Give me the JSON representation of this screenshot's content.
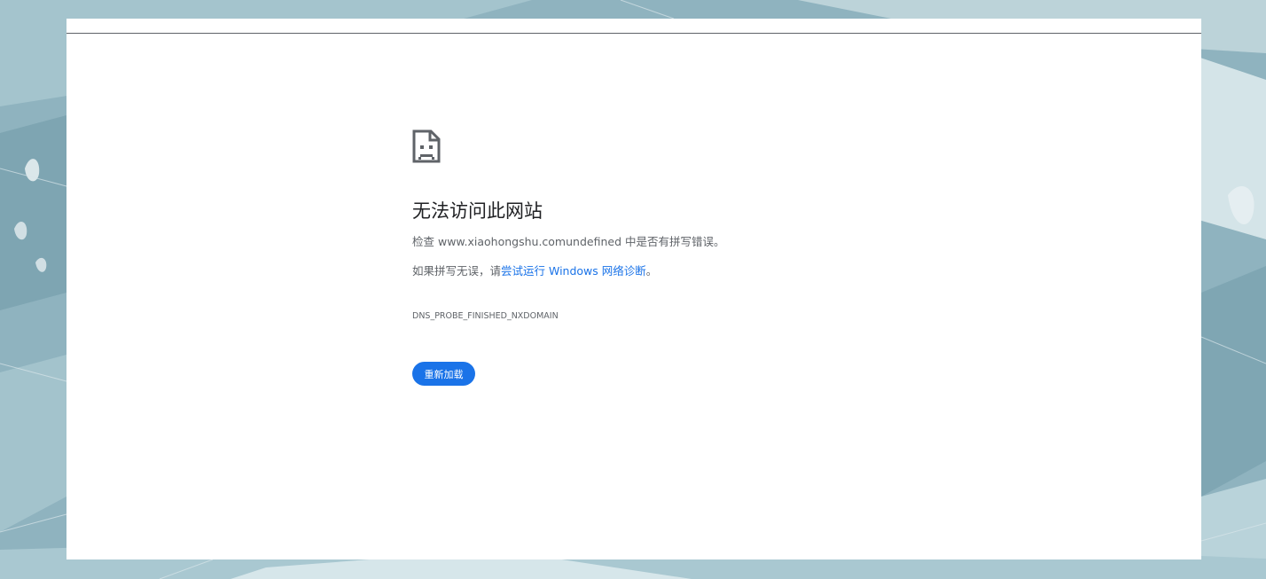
{
  "error_page": {
    "icon": "sad-page-icon",
    "title": "无法访问此网站",
    "check_prefix": "检查 ",
    "url": "www.xiaohongshu.comundefined",
    "check_suffix": " 中是否有拼写错误。",
    "spelling_prefix": "如果拼写无误，请",
    "diagnostics_link": "尝试运行 Windows 网络诊断",
    "spelling_suffix": "。",
    "error_code": "DNS_PROBE_FINISHED_NXDOMAIN",
    "reload_label": "重新加载"
  },
  "colors": {
    "accent": "#1a73e8",
    "title_text": "#202124",
    "body_text": "#5f6368",
    "page_bg": "#ffffff",
    "backdrop": "#8fb3bf"
  }
}
